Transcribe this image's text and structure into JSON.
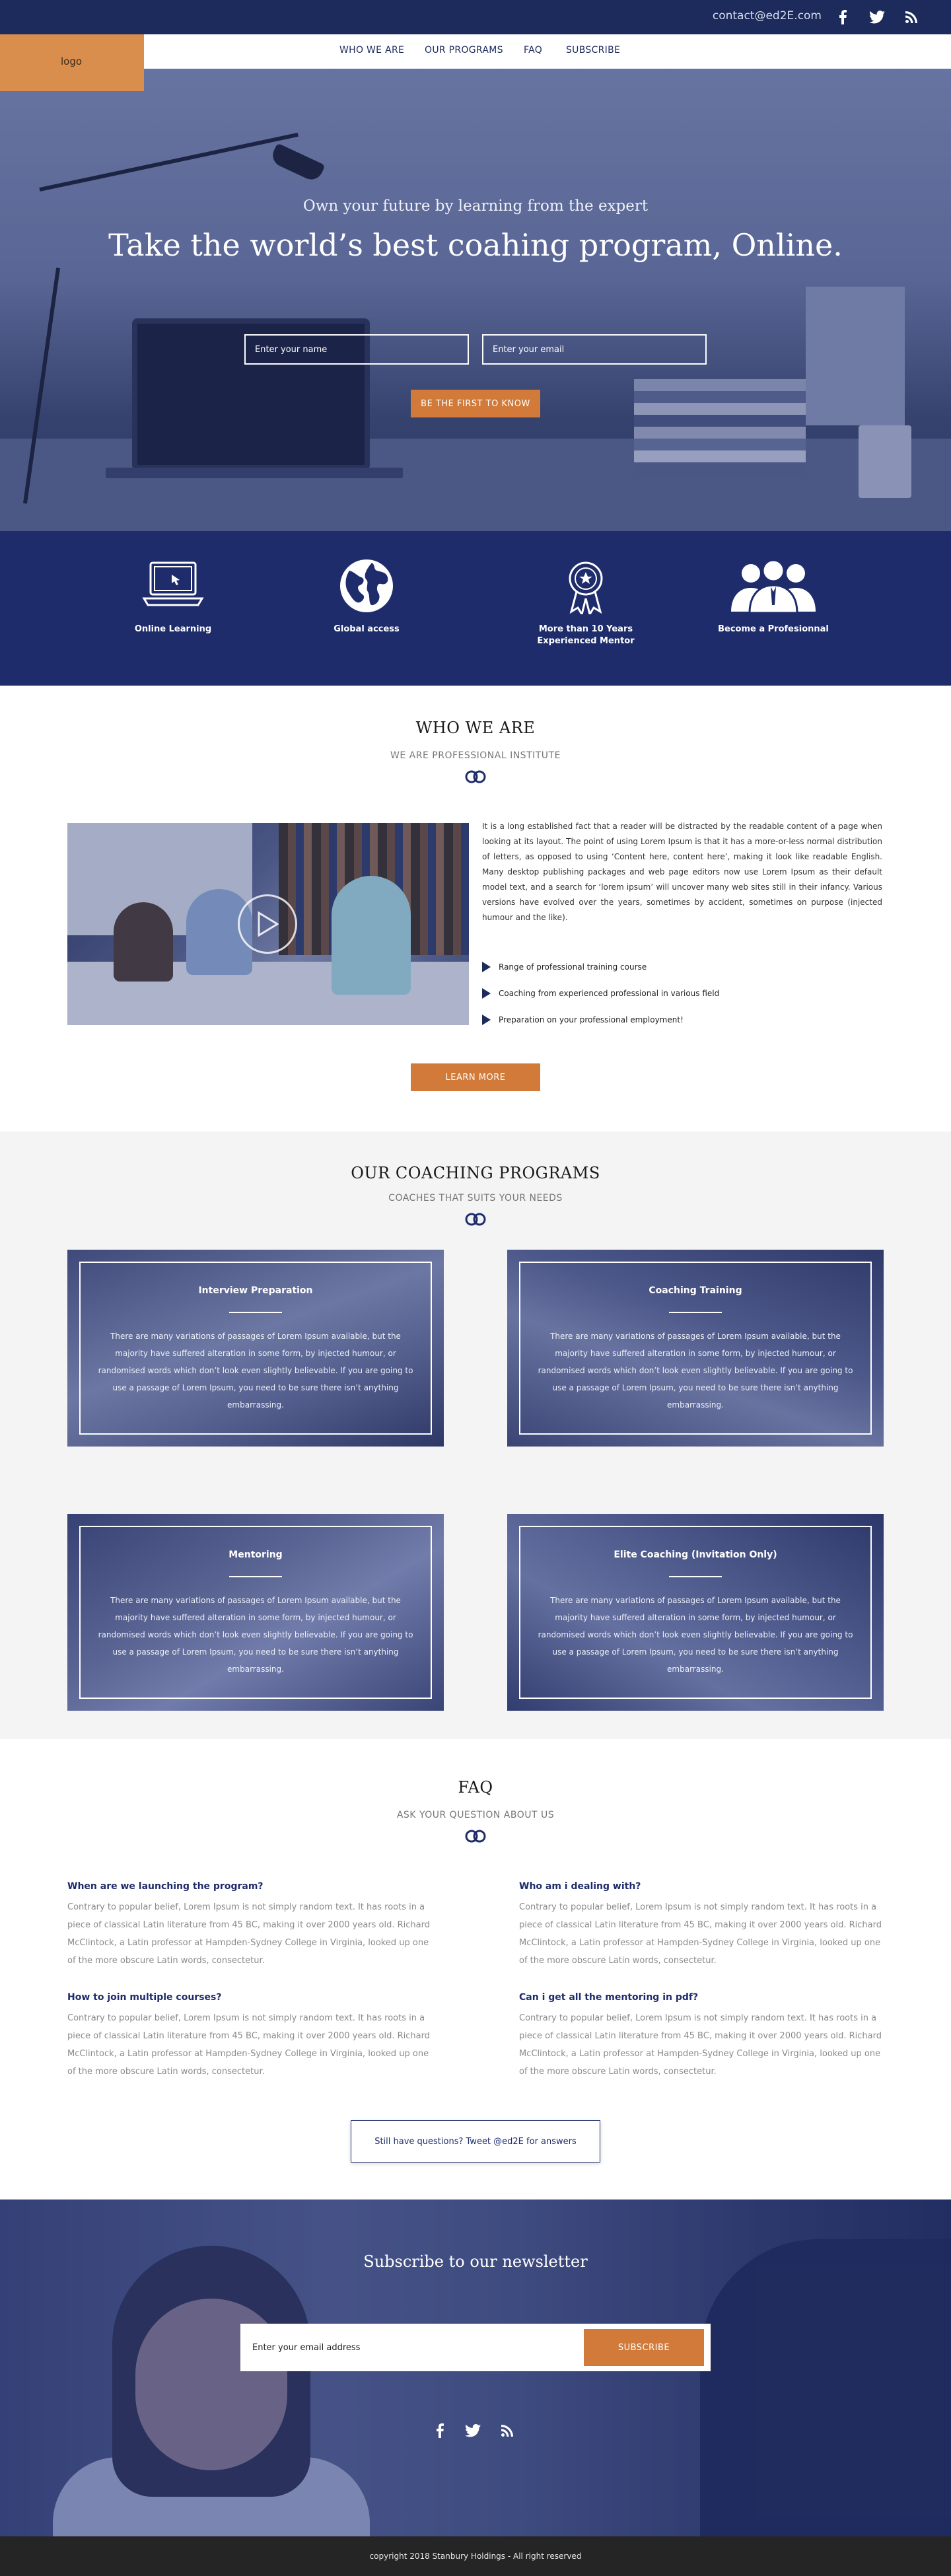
{
  "topbar": {
    "contact": "contact@ed2E.com",
    "social": [
      {
        "icon": "facebook-icon"
      },
      {
        "icon": "twitter-icon"
      },
      {
        "icon": "rss-icon"
      }
    ]
  },
  "logo": "logo",
  "nav": [
    "WHO WE ARE",
    "OUR PROGRAMS",
    "FAQ",
    "SUBSCRIBE"
  ],
  "hero": {
    "subtitle": "Own your future by learning from the expert",
    "title": "Take the world’s best coahing program, Online.",
    "name_placeholder": "Enter your name",
    "email_placeholder": "Enter your email",
    "cta": "BE THE FIRST TO KNOW"
  },
  "features": [
    {
      "icon": "laptop-icon",
      "label": "Online Learning"
    },
    {
      "icon": "globe-icon",
      "label": "Global access"
    },
    {
      "icon": "award-icon",
      "label": "More than 10 Years Experienced Mentor"
    },
    {
      "icon": "people-icon",
      "label": "Become a Profesionnal"
    }
  ],
  "who": {
    "title": "WHO WE ARE",
    "subtitle": "WE ARE PROFESSIONAL INSTITUTE",
    "text": "It is a long established fact that a reader will be distracted by the readable content of a page when looking at its layout. The point of using Lorem Ipsum is that it has a more-or-less normal distribution of letters, as opposed to using ‘Content here, content here’, making it look like readable English. Many desktop publishing packages and web page editors now use Lorem Ipsum as their default model text, and a search for ‘lorem ipsum’ will uncover many web sites still in their infancy. Various versions have evolved over the years, sometimes by accident, sometimes on purpose (injected humour and the like).",
    "bullets": [
      "Range of professional training course",
      "Coaching from experienced professional in various field",
      "Preparation on your professional employment!"
    ],
    "button": "LEARN MORE"
  },
  "programs": {
    "title": "OUR COACHING PROGRAMS",
    "subtitle": "COACHES THAT SUITS YOUR NEEDS",
    "cards": [
      {
        "title": "Interview Preparation",
        "text": "There are many variations of passages of Lorem Ipsum available, but the majority have suffered alteration in some form, by injected humour, or randomised words which don’t look even slightly believable. If you are going to use a passage of Lorem Ipsum, you need to be sure there isn’t anything embarrassing."
      },
      {
        "title": "Coaching Training",
        "text": "There are many variations of passages of Lorem Ipsum available, but the majority have suffered alteration in some form, by injected humour, or randomised words which don’t look even slightly believable. If you are going to use a passage of Lorem Ipsum, you need to be sure there isn’t anything embarrassing."
      },
      {
        "title": "Mentoring",
        "text": "There are many variations of passages of Lorem Ipsum available, but the majority have suffered alteration in some form, by injected humour, or randomised words which don’t look even slightly believable. If you are going to use a passage of Lorem Ipsum, you need to be sure there isn’t anything embarrassing."
      },
      {
        "title": "Elite Coaching (Invitation Only)",
        "text": "There are many variations of passages of Lorem Ipsum available, but the majority have suffered alteration in some form, by injected humour, or randomised words which don’t look even slightly believable. If you are going to use a passage of Lorem Ipsum, you need to be sure there isn’t anything embarrassing."
      }
    ]
  },
  "faq": {
    "title": "FAQ",
    "subtitle": "ASK YOUR QUESTION ABOUT US",
    "items": [
      {
        "q": "When are we launching the program?",
        "a": "Contrary to popular belief, Lorem Ipsum is not simply random text. It has roots in a piece of classical Latin literature from 45 BC, making it over 2000 years old. Richard McClintock, a Latin professor at Hampden-Sydney College in Virginia, looked up one of the more obscure Latin words, consectetur."
      },
      {
        "q": "Who am i dealing with?",
        "a": "Contrary to popular belief, Lorem Ipsum is not simply random text. It has roots in a piece of classical Latin literature from 45 BC, making it over 2000 years old. Richard McClintock, a Latin professor at Hampden-Sydney College in Virginia, looked up one of the more obscure Latin words, consectetur."
      },
      {
        "q": "How to join multiple courses?",
        "a": "Contrary to popular belief, Lorem Ipsum is not simply random text. It has roots in a piece of classical Latin literature from 45 BC, making it over 2000 years old. Richard McClintock, a Latin professor at Hampden-Sydney College in Virginia, looked up one of the more obscure Latin words, consectetur."
      },
      {
        "q": "Can i get all the mentoring in pdf?",
        "a": "Contrary to popular belief, Lorem Ipsum is not simply random text. It has roots in a piece of classical Latin literature from 45 BC, making it over 2000 years old. Richard McClintock, a Latin professor at Hampden-Sydney College in Virginia, looked up one of the more obscure Latin words, consectetur."
      }
    ],
    "tweet": "Still have questions? Tweet @ed2E for answers"
  },
  "newsletter": {
    "title": "Subscribe to our newsletter",
    "placeholder": "Enter your email address",
    "button": "SUBSCRIBE"
  },
  "footer": "copyright 2018 Stanbury Holdings - All right reserved",
  "colors": {
    "navy": "#1c2b5c",
    "orange": "#d17a39",
    "logo_bg": "#d98e4e"
  }
}
